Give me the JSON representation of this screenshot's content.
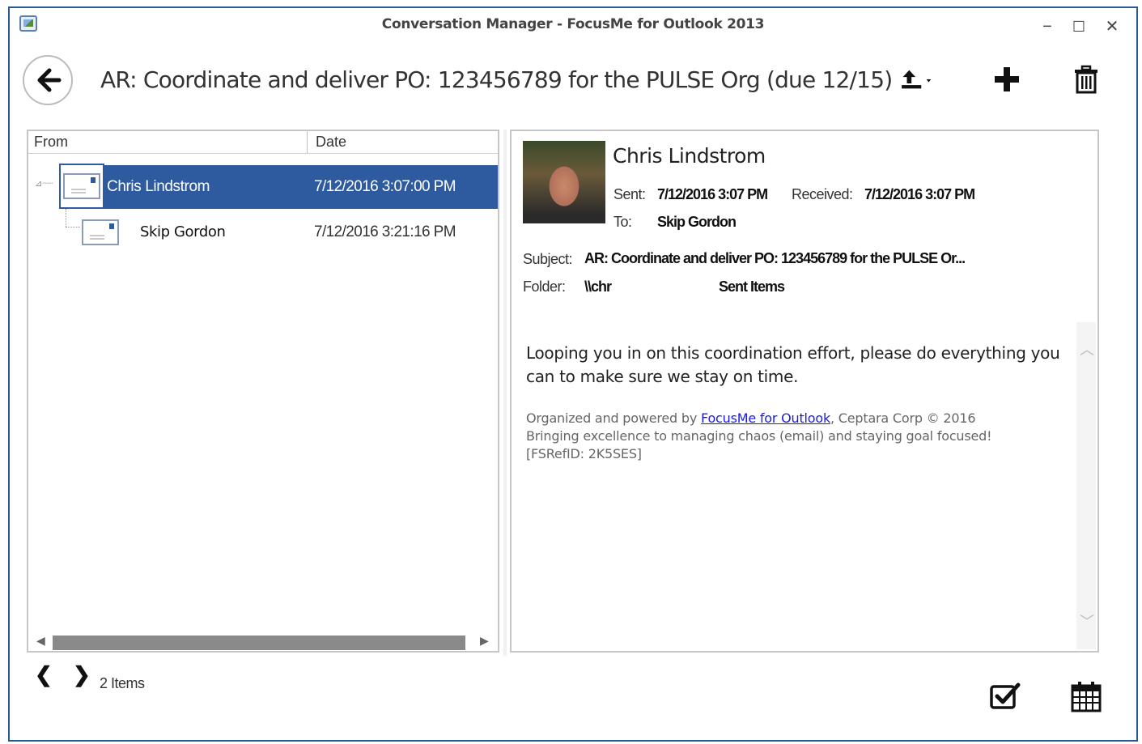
{
  "window": {
    "title": "Conversation Manager - FocusMe for Outlook 2013",
    "minimize_symbol": "−",
    "maximize_symbol": "☐",
    "close_symbol": "✕"
  },
  "header": {
    "subject_title": "AR: Coordinate and deliver PO: 123456789 for the PULSE Org (due 12/15)",
    "icons": [
      "back-arrow-icon",
      "export-upload-icon",
      "plus-icon",
      "trash-icon"
    ]
  },
  "list": {
    "columns": {
      "from": "From",
      "date": "Date"
    },
    "rows": [
      {
        "from": "Chris Lindstrom",
        "date": "7/12/2016 3:07:00 PM",
        "selected": true
      },
      {
        "from": "Skip Gordon",
        "date": "7/12/2016 3:21:16 PM",
        "selected": false
      }
    ]
  },
  "detail": {
    "sender_name": "Chris Lindstrom",
    "sent_label": "Sent:",
    "sent_value": "7/12/2016 3:07 PM",
    "received_label": "Received:",
    "received_value": "7/12/2016 3:07 PM",
    "to_label": "To:",
    "to_value": "Skip Gordon",
    "subject_label": "Subject:",
    "subject_value": "AR: Coordinate and deliver PO: 123456789 for the PULSE Or...",
    "folder_label": "Folder:",
    "folder_value": "\\\\chr",
    "folder_name": "Sent Items",
    "body": "Looping you in on this coordination effort, please do everything you can to make sure we stay on time.",
    "sig_prefix": "Organized and powered by ",
    "sig_link": "FocusMe for Outlook",
    "sig_suffix": ", Ceptara Corp © 2016",
    "sig_line2": "Bringing excellence to managing chaos (email) and staying goal focused!",
    "sig_line3": "[FSRefID: 2K5SES]"
  },
  "footer": {
    "prev_symbol": "❮",
    "next_symbol": "❯",
    "items_count": "2 Items",
    "icons": [
      "checkbox-task-icon",
      "calendar-icon"
    ]
  },
  "colors": {
    "selection": "#2e5aa0",
    "window_border": "#2b5797",
    "link": "#1a1aee"
  }
}
